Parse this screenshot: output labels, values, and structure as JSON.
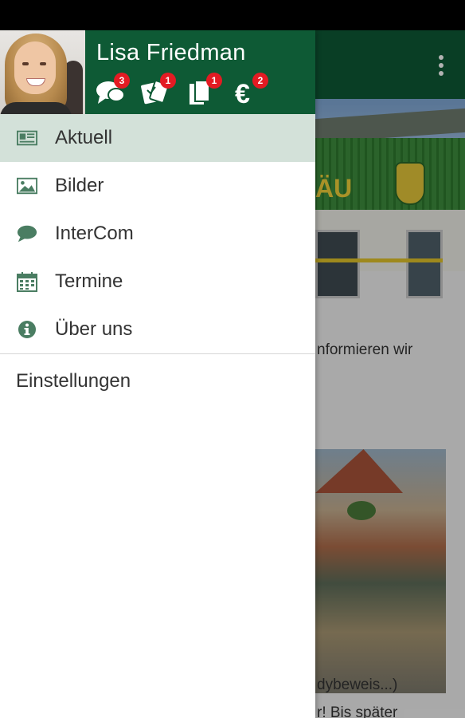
{
  "user": {
    "name": "Lisa Friedman"
  },
  "header_icons": [
    {
      "icon": "chat-bubbles-icon",
      "count": "3"
    },
    {
      "icon": "tickets-icon",
      "count": "1"
    },
    {
      "icon": "documents-icon",
      "count": "1"
    },
    {
      "icon": "euro-icon",
      "count": "2"
    }
  ],
  "menu": [
    {
      "label": "Aktuell",
      "icon": "newspaper-icon",
      "active": true
    },
    {
      "label": "Bilder",
      "icon": "image-icon",
      "active": false
    },
    {
      "label": "InterCom",
      "icon": "chat-bubble-icon",
      "active": false
    },
    {
      "label": "Termine",
      "icon": "calendar-icon",
      "active": false
    },
    {
      "label": "Über uns",
      "icon": "info-icon",
      "active": false
    }
  ],
  "settings_label": "Einstellungen",
  "background_content": {
    "sign_text": "ÄU",
    "text_line_1": "nformieren wir",
    "text_line_2": "dybeweis...)",
    "text_line_3": "r! Bis später"
  },
  "colors": {
    "primary": "#0e5a35",
    "icon": "#4a7d62",
    "active_bg": "#d3e1d9",
    "badge": "#e31b23"
  }
}
